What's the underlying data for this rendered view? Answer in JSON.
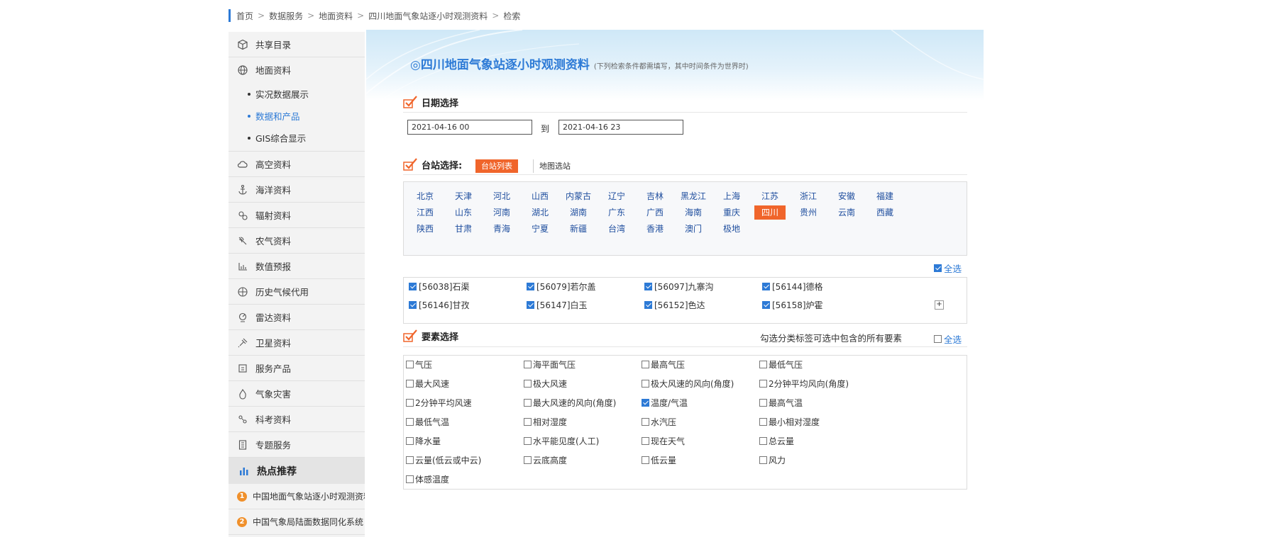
{
  "breadcrumb": [
    "首页",
    "数据服务",
    "地面资料",
    "四川地面气象站逐小时观测资料",
    "检索"
  ],
  "breadcrumb_sep": ">",
  "sidebar": {
    "items": [
      {
        "label": "共享目录",
        "icon": "cube-icon"
      },
      {
        "label": "地面资料",
        "icon": "globe-icon"
      }
    ],
    "subitems": [
      {
        "label": "实况数据展示",
        "active": false
      },
      {
        "label": "数据和产品",
        "active": true
      },
      {
        "label": "GIS综合显示",
        "active": false
      }
    ],
    "items2": [
      {
        "label": "高空资料",
        "icon": "cloud-icon"
      },
      {
        "label": "海洋资料",
        "icon": "anchor-icon"
      },
      {
        "label": "辐射资料",
        "icon": "radiation-icon"
      },
      {
        "label": "农气资料",
        "icon": "plant-icon"
      },
      {
        "label": "数值预报",
        "icon": "bar-icon"
      },
      {
        "label": "历史气候代用",
        "icon": "history-globe-icon"
      },
      {
        "label": "雷达资料",
        "icon": "radar-icon"
      },
      {
        "label": "卫星资料",
        "icon": "satellite-icon"
      },
      {
        "label": "服务产品",
        "icon": "service-icon"
      },
      {
        "label": "气象灾害",
        "icon": "fire-icon"
      },
      {
        "label": "科考资料",
        "icon": "research-icon"
      },
      {
        "label": "专题服务",
        "icon": "document-icon"
      }
    ],
    "hot_header": "热点推荐",
    "hot_items": [
      {
        "num": "1",
        "label": "中国地面气象站逐小时观测资料"
      },
      {
        "num": "2",
        "label": "中国气象局陆面数据同化系统"
      }
    ]
  },
  "banner": {
    "title": "◎四川地面气象站逐小时观测资料",
    "subtitle": "(下列检索条件都需填写，其中时间条件为世界时)"
  },
  "date_section": {
    "label": "日期选择",
    "start": "2021-04-16 00",
    "to_label": "到",
    "end": "2021-04-16 23"
  },
  "station_section": {
    "label": "台站选择:",
    "tab_active": "台站列表",
    "tab_other": "地图选站"
  },
  "provinces": [
    [
      "北京",
      "天津",
      "河北",
      "山西",
      "内蒙古",
      "辽宁",
      "吉林",
      "黑龙江",
      "上海",
      "江苏",
      "浙江",
      "安徽",
      "福建"
    ],
    [
      "江西",
      "山东",
      "河南",
      "湖北",
      "湖南",
      "广东",
      "广西",
      "海南",
      "重庆",
      "四川",
      "贵州",
      "云南",
      "西藏"
    ],
    [
      "陕西",
      "甘肃",
      "青海",
      "宁夏",
      "新疆",
      "台湾",
      "香港",
      "澳门",
      "极地"
    ]
  ],
  "active_province": "四川",
  "select_all_label": "全选",
  "stations": [
    {
      "label": "[56038]石渠",
      "checked": true
    },
    {
      "label": "[56079]若尔盖",
      "checked": true
    },
    {
      "label": "[56097]九寨沟",
      "checked": true
    },
    {
      "label": "[56144]德格",
      "checked": true
    },
    {
      "label": "[56146]甘孜",
      "checked": true
    },
    {
      "label": "[56147]白玉",
      "checked": true
    },
    {
      "label": "[56152]色达",
      "checked": true
    },
    {
      "label": "[56158]炉霍",
      "checked": true
    }
  ],
  "plus_label": "+",
  "element_section": {
    "label": "要素选择",
    "hint": "勾选分类标签可选中包含的所有要素",
    "select_all_label": "全选"
  },
  "elements": [
    {
      "label": "气压",
      "checked": false
    },
    {
      "label": "海平面气压",
      "checked": false
    },
    {
      "label": "最高气压",
      "checked": false
    },
    {
      "label": "最低气压",
      "checked": false
    },
    {
      "label": "最大风速",
      "checked": false
    },
    {
      "label": "极大风速",
      "checked": false
    },
    {
      "label": "极大风速的风向(角度)",
      "checked": false
    },
    {
      "label": "2分钟平均风向(角度)",
      "checked": false
    },
    {
      "label": "2分钟平均风速",
      "checked": false
    },
    {
      "label": "最大风速的风向(角度)",
      "checked": false
    },
    {
      "label": "温度/气温",
      "checked": true
    },
    {
      "label": "最高气温",
      "checked": false
    },
    {
      "label": "最低气温",
      "checked": false
    },
    {
      "label": "相对湿度",
      "checked": false
    },
    {
      "label": "水汽压",
      "checked": false
    },
    {
      "label": "最小相对湿度",
      "checked": false
    },
    {
      "label": "降水量",
      "checked": false
    },
    {
      "label": "水平能见度(人工)",
      "checked": false
    },
    {
      "label": "现在天气",
      "checked": false
    },
    {
      "label": "总云量",
      "checked": false
    },
    {
      "label": "云量(低云或中云)",
      "checked": false
    },
    {
      "label": "云底高度",
      "checked": false
    },
    {
      "label": "低云量",
      "checked": false
    },
    {
      "label": "风力",
      "checked": false
    },
    {
      "label": "体感温度",
      "checked": false
    }
  ],
  "colors": {
    "accent": "#2d7ad6",
    "orange": "#f0652b",
    "province_text": "#1f4e9e"
  }
}
